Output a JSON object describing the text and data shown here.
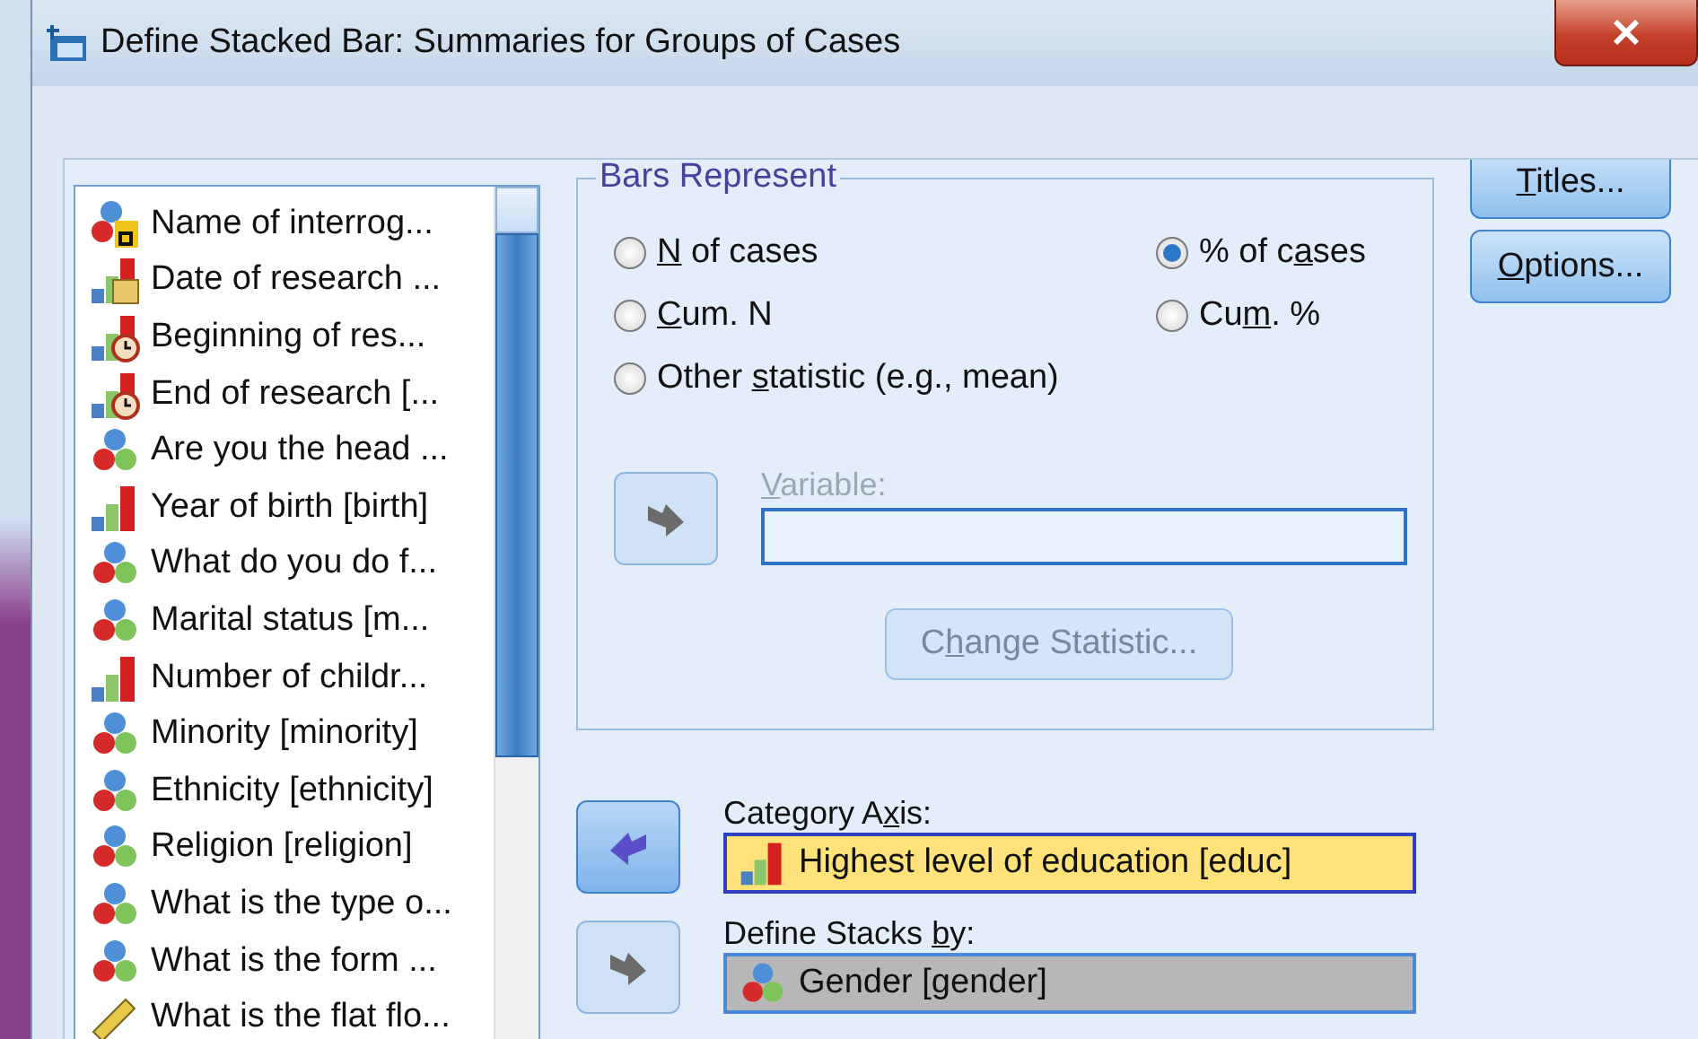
{
  "window": {
    "title": "Define Stacked Bar: Summaries for Groups of Cases"
  },
  "variables": [
    {
      "kind": "string",
      "label": "Name of interrog..."
    },
    {
      "kind": "date",
      "label": "Date of research ..."
    },
    {
      "kind": "time",
      "label": "Beginning of res..."
    },
    {
      "kind": "time",
      "label": "End of research [..."
    },
    {
      "kind": "nominal",
      "label": "Are you the head ..."
    },
    {
      "kind": "scale",
      "label": "Year of birth [birth]"
    },
    {
      "kind": "nominal",
      "label": "What do you do f..."
    },
    {
      "kind": "nominal",
      "label": "Marital status [m..."
    },
    {
      "kind": "scale",
      "label": "Number of childr..."
    },
    {
      "kind": "nominal",
      "label": "Minority [minority]"
    },
    {
      "kind": "nominal",
      "label": "Ethnicity [ethnicity]"
    },
    {
      "kind": "nominal",
      "label": "Religion [religion]"
    },
    {
      "kind": "nominal",
      "label": "What is the type o..."
    },
    {
      "kind": "nominal",
      "label": "What is the form ..."
    },
    {
      "kind": "ruler",
      "label": "What is the flat flo..."
    }
  ],
  "bars_represent": {
    "title": "Bars Represent",
    "options": [
      {
        "key": "N",
        "post": " of cases",
        "selected": false
      },
      {
        "pre": "% of c",
        "key": "a",
        "post": "ses",
        "selected": true
      },
      {
        "key": "C",
        "post": "um. N",
        "selected": false
      },
      {
        "pre": "Cu",
        "key": "m",
        "post": ". %",
        "selected": false
      },
      {
        "pre": "Other ",
        "key": "s",
        "post": "tatistic (e.g., mean)",
        "selected": false
      }
    ],
    "variable": {
      "label": {
        "key": "V",
        "post": "ariable:"
      },
      "disabled": true
    },
    "change_statistic": {
      "label": {
        "pre": "C",
        "key": "h",
        "post": "ange Statistic..."
      },
      "disabled": true
    }
  },
  "category_axis": {
    "label": {
      "pre": "Category A",
      "key": "x",
      "post": "is:"
    },
    "value": {
      "kind": "scale",
      "text": "Highest level of education [educ]"
    },
    "disabled": false
  },
  "define_stacks": {
    "label": {
      "pre": "Define Stacks ",
      "key": "b",
      "post": "y:"
    },
    "value": {
      "kind": "nominal",
      "text": "Gender [gender]"
    },
    "disabled": true
  },
  "buttons": [
    {
      "key": "T",
      "post": "itles..."
    },
    {
      "key": "O",
      "post": "ptions..."
    }
  ]
}
